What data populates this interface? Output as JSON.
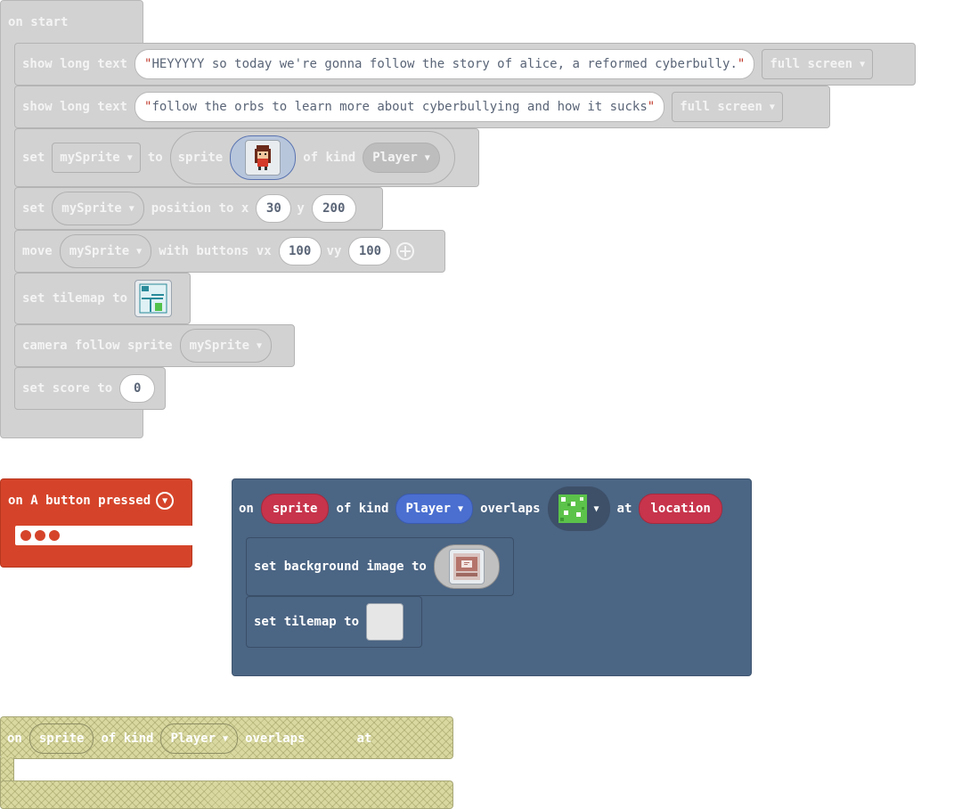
{
  "on_start": {
    "hat_label": "on start",
    "show1": {
      "label": "show long text",
      "text": "HEYYYYY so today we're gonna follow the story of alice, a reformed cyberbully.",
      "mode": "full screen"
    },
    "show2": {
      "label": "show long text",
      "text": "follow the orbs to learn more about cyberbullying and how it sucks ",
      "mode": "full screen"
    },
    "set_sprite": {
      "set": "set",
      "var": "mySprite",
      "to": "to",
      "sprite": "sprite",
      "of_kind": "of kind",
      "kind": "Player"
    },
    "set_pos": {
      "set": "set",
      "var": "mySprite",
      "position_to_x": "position to x",
      "x": "30",
      "y_label": "y",
      "y": "200"
    },
    "move": {
      "move": "move",
      "var": "mySprite",
      "with_buttons_vx": "with buttons vx",
      "vx": "100",
      "vy_label": "vy",
      "vy": "100"
    },
    "set_tilemap": {
      "label": "set tilemap to"
    },
    "camera": {
      "label": "camera follow sprite",
      "var": "mySprite"
    },
    "set_score": {
      "label": "set score to",
      "value": "0"
    }
  },
  "a_button": {
    "label": "on A button pressed"
  },
  "overlap_block": {
    "on": "on",
    "sprite": "sprite",
    "of_kind": "of kind",
    "kind": "Player",
    "overlaps": "overlaps",
    "at": "at",
    "location": "location",
    "bg_label": "set background image to",
    "tilemap_label": "set tilemap to"
  },
  "warning_block": {
    "on": "on",
    "sprite": "sprite",
    "of_kind": "of kind",
    "kind": "Player",
    "overlaps": "overlaps",
    "at": "at"
  },
  "colors": {
    "disabled_grey": "#d2d2d2",
    "event_red": "#d5442a",
    "scene_blue": "#4b6584",
    "sprite_red": "#c7344c",
    "kind_blue": "#4a6fd0"
  }
}
